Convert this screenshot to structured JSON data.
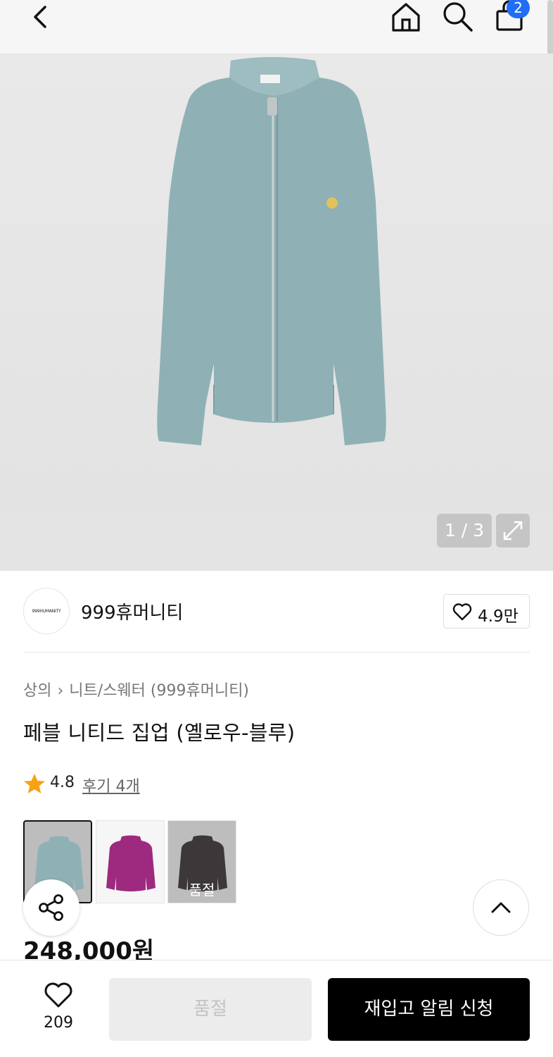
{
  "header": {
    "back_icon": "chevron-left-icon",
    "home_icon": "home-icon",
    "search_icon": "search-icon",
    "cart_icon": "shopping-bag-icon",
    "cart_count": "2",
    "accent_color": "#1f6ef5"
  },
  "gallery": {
    "counter": "1 / 3",
    "expand_icon": "expand-icon",
    "product_color": "#8fb1b5"
  },
  "brand": {
    "logo_text": "999HUMANITY",
    "name": "999휴머니티",
    "like_count": "4.9만"
  },
  "breadcrumb": {
    "category": "상의",
    "subcategory": "니트/스웨터 (999휴머니티)"
  },
  "product": {
    "title": "페블 니티드 집업 (옐로우-블루)",
    "rating": "4.8",
    "review_label": "후기 4개",
    "price": "248,000원"
  },
  "swatches": [
    {
      "color": "#8fb1b5",
      "sold_out": false,
      "label": ""
    },
    {
      "color": "#9e2a7f",
      "sold_out": false,
      "label": ""
    },
    {
      "color": "#3c3839",
      "sold_out": true,
      "label": "품절"
    }
  ],
  "floating": {
    "share_icon": "share-icon",
    "scroll_top_icon": "chevron-up-icon"
  },
  "bottom_bar": {
    "wish_count": "209",
    "soldout_label": "품절",
    "restock_label": "재입고 알림 신청"
  }
}
